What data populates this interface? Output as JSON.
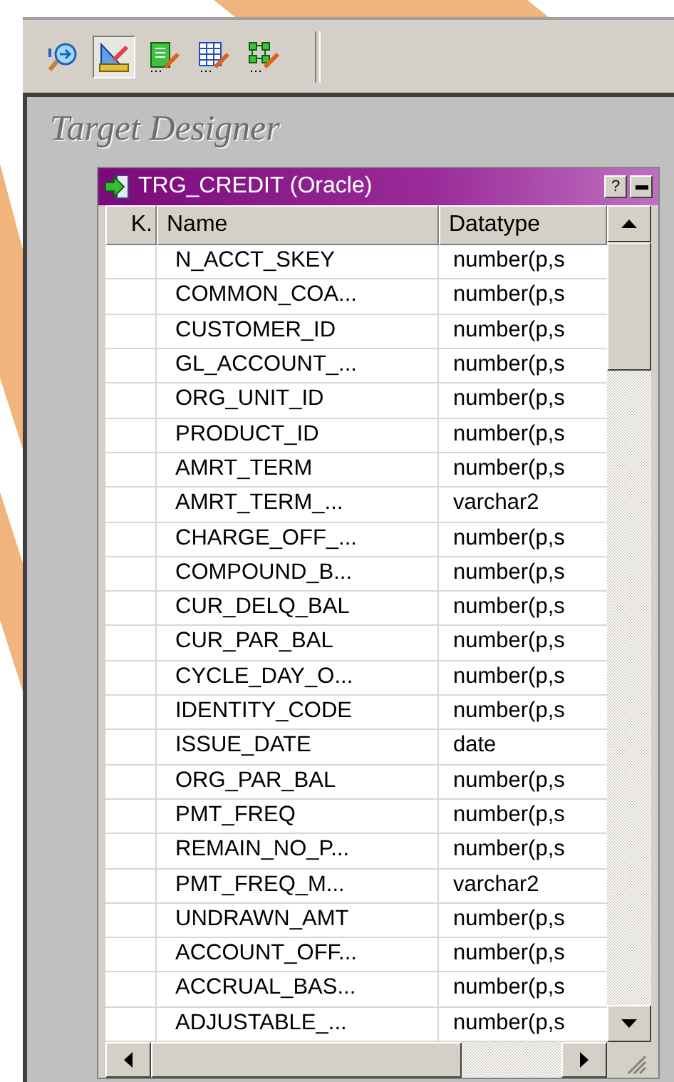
{
  "toolbar": {
    "tools": [
      {
        "selected": false
      },
      {
        "selected": true
      },
      {
        "selected": false
      },
      {
        "selected": false
      },
      {
        "selected": false
      }
    ]
  },
  "workspace": {
    "title": "Target Designer"
  },
  "table_window": {
    "title": "TRG_CREDIT (Oracle)",
    "help_button": "?",
    "columns": [
      "K.",
      "Name",
      "Datatype"
    ],
    "rows": [
      {
        "name": "N_ACCT_SKEY",
        "datatype": "number(p,s"
      },
      {
        "name": "COMMON_COA...",
        "datatype": "number(p,s"
      },
      {
        "name": "CUSTOMER_ID",
        "datatype": "number(p,s"
      },
      {
        "name": "GL_ACCOUNT_...",
        "datatype": "number(p,s"
      },
      {
        "name": "ORG_UNIT_ID",
        "datatype": "number(p,s"
      },
      {
        "name": "PRODUCT_ID",
        "datatype": "number(p,s"
      },
      {
        "name": "AMRT_TERM",
        "datatype": "number(p,s"
      },
      {
        "name": "AMRT_TERM_...",
        "datatype": "varchar2"
      },
      {
        "name": "CHARGE_OFF_...",
        "datatype": "number(p,s"
      },
      {
        "name": "COMPOUND_B...",
        "datatype": "number(p,s"
      },
      {
        "name": "CUR_DELQ_BAL",
        "datatype": "number(p,s"
      },
      {
        "name": "CUR_PAR_BAL",
        "datatype": "number(p,s"
      },
      {
        "name": "CYCLE_DAY_O...",
        "datatype": "number(p,s"
      },
      {
        "name": "IDENTITY_CODE",
        "datatype": "number(p,s"
      },
      {
        "name": "ISSUE_DATE",
        "datatype": "date"
      },
      {
        "name": "ORG_PAR_BAL",
        "datatype": "number(p,s"
      },
      {
        "name": "PMT_FREQ",
        "datatype": "number(p,s"
      },
      {
        "name": "REMAIN_NO_P...",
        "datatype": "number(p,s"
      },
      {
        "name": "PMT_FREQ_M...",
        "datatype": "varchar2"
      },
      {
        "name": "UNDRAWN_AMT",
        "datatype": "number(p,s"
      },
      {
        "name": "ACCOUNT_OFF...",
        "datatype": "number(p,s"
      },
      {
        "name": "ACCRUAL_BAS...",
        "datatype": "number(p,s"
      },
      {
        "name": "ADJUSTABLE_...",
        "datatype": "number(p,s"
      }
    ]
  }
}
